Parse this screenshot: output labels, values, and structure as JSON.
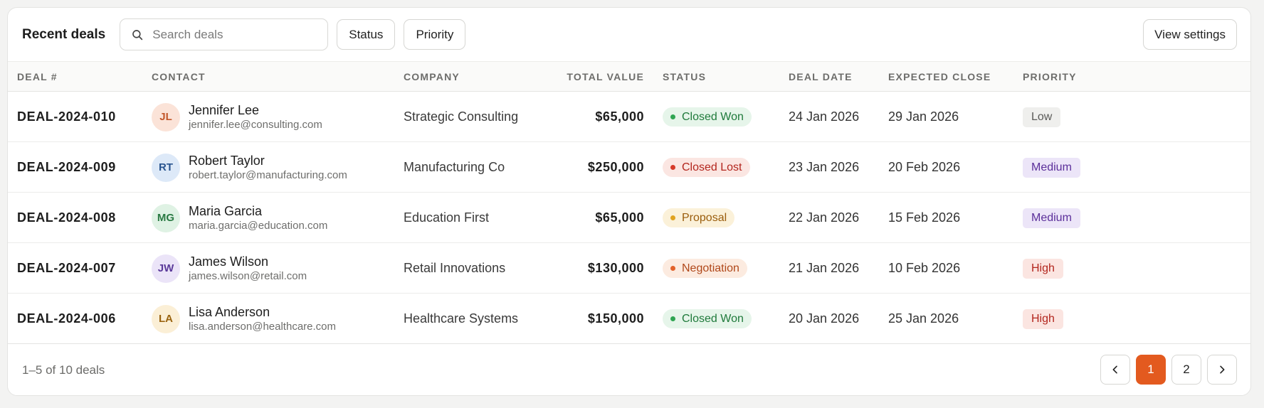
{
  "toolbar": {
    "title": "Recent deals",
    "search_placeholder": "Search deals",
    "status_filter": "Status",
    "priority_filter": "Priority",
    "view_settings": "View settings"
  },
  "columns": [
    "DEAL #",
    "CONTACT",
    "COMPANY",
    "TOTAL VALUE",
    "STATUS",
    "DEAL DATE",
    "EXPECTED CLOSE",
    "PRIORITY"
  ],
  "rows": [
    {
      "deal": "DEAL-2024-010",
      "initials": "JL",
      "name": "Jennifer Lee",
      "email": "jennifer.lee@consulting.com",
      "avatar_bg": "#fbe3d8",
      "avatar_fg": "#c2572b",
      "company": "Strategic Consulting",
      "value": "$65,000",
      "status": "Closed Won",
      "status_bg": "#e6f5ea",
      "status_fg": "#1f7a3b",
      "status_dot": "#2fa552",
      "deal_date": "24 Jan 2026",
      "expected_close": "29 Jan 2026",
      "priority": "Low",
      "priority_bg": "#efefed",
      "priority_fg": "#5a5a58"
    },
    {
      "deal": "DEAL-2024-009",
      "initials": "RT",
      "name": "Robert Taylor",
      "email": "robert.taylor@manufacturing.com",
      "avatar_bg": "#dde9f8",
      "avatar_fg": "#2a5590",
      "company": "Manufacturing Co",
      "value": "$250,000",
      "status": "Closed Lost",
      "status_bg": "#fbe6e2",
      "status_fg": "#b3261e",
      "status_dot": "#d63a2a",
      "deal_date": "23 Jan 2026",
      "expected_close": "20 Feb 2026",
      "priority": "Medium",
      "priority_bg": "#ece5f8",
      "priority_fg": "#5b2f9a"
    },
    {
      "deal": "DEAL-2024-008",
      "initials": "MG",
      "name": "Maria Garcia",
      "email": "maria.garcia@education.com",
      "avatar_bg": "#dff2e4",
      "avatar_fg": "#2a7a43",
      "company": "Education First",
      "value": "$65,000",
      "status": "Proposal",
      "status_bg": "#fbf1d9",
      "status_fg": "#9a5d0c",
      "status_dot": "#e0a320",
      "deal_date": "22 Jan 2026",
      "expected_close": "15 Feb 2026",
      "priority": "Medium",
      "priority_bg": "#ece5f8",
      "priority_fg": "#5b2f9a"
    },
    {
      "deal": "DEAL-2024-007",
      "initials": "JW",
      "name": "James Wilson",
      "email": "james.wilson@retail.com",
      "avatar_bg": "#ebe4f8",
      "avatar_fg": "#5b3a9a",
      "company": "Retail Innovations",
      "value": "$130,000",
      "status": "Negotiation",
      "status_bg": "#fcebe0",
      "status_fg": "#b0481a",
      "status_dot": "#e2622a",
      "deal_date": "21 Jan 2026",
      "expected_close": "10 Feb 2026",
      "priority": "High",
      "priority_bg": "#fbe5e1",
      "priority_fg": "#b3261e"
    },
    {
      "deal": "DEAL-2024-006",
      "initials": "LA",
      "name": "Lisa Anderson",
      "email": "lisa.anderson@healthcare.com",
      "avatar_bg": "#fbefd6",
      "avatar_fg": "#9a6410",
      "company": "Healthcare Systems",
      "value": "$150,000",
      "status": "Closed Won",
      "status_bg": "#e6f5ea",
      "status_fg": "#1f7a3b",
      "status_dot": "#2fa552",
      "deal_date": "20 Jan 2026",
      "expected_close": "25 Jan 2026",
      "priority": "High",
      "priority_bg": "#fbe5e1",
      "priority_fg": "#b3261e"
    }
  ],
  "footer": {
    "range_text": "1–5 of 10 deals",
    "pages": [
      "1",
      "2"
    ],
    "active_page": "1",
    "prev_icon": "chevron-left-icon",
    "next_icon": "chevron-right-icon"
  },
  "colors": {
    "accent": "#e35a1f"
  }
}
